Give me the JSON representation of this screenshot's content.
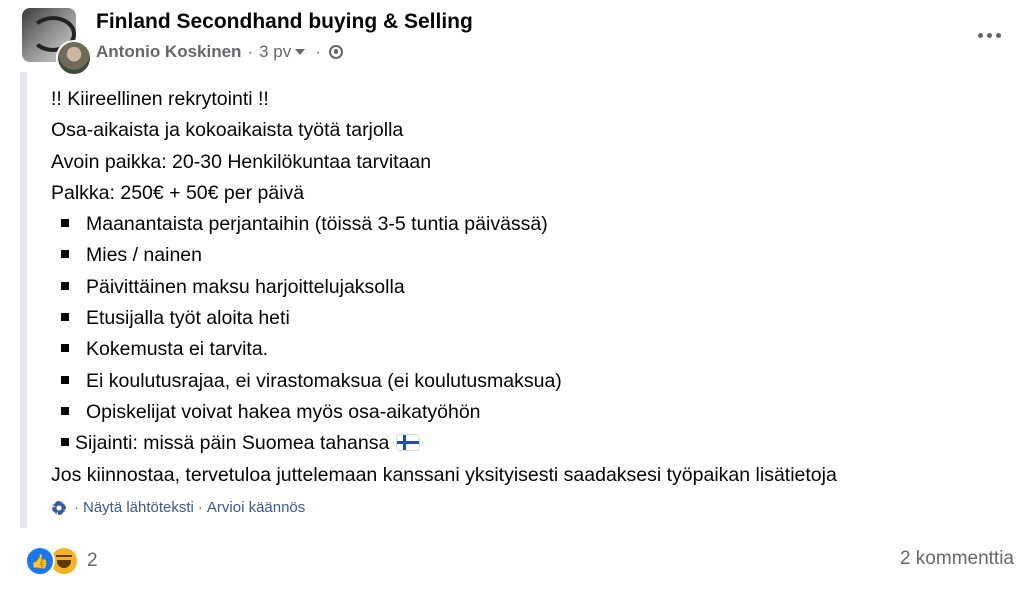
{
  "header": {
    "group_name": "Finland Secondhand buying & Selling",
    "author": "Antonio Koskinen",
    "separator": "·",
    "time": "3 pv",
    "privacy_icon": "globe-icon",
    "more_icon": "more-options-icon"
  },
  "post": {
    "lines": [
      "!!  Kiireellinen rekrytointi !!",
      "Osa-aikaista ja kokoaikaista työtä tarjolla",
      "Avoin paikka: 20-30 Henkilökuntaa tarvitaan",
      "Palkka: 250€ + 50€ per päivä"
    ],
    "bullets": [
      "Maanantaista perjantaihin (töissä 3-5 tuntia päivässä)",
      "Mies / nainen",
      "Päivittäinen maksu harjoittelujaksolla",
      "Etusijalla työt aloita heti",
      "Kokemusta ei tarvita.",
      "Ei koulutusrajaa, ei virastomaksua (ei koulutusmaksua)",
      "Opiskelijat voivat hakea myös osa-aikatyöhön",
      "Sijainti: missä päin Suomea tahansa"
    ],
    "location_flag": "finland-flag-icon",
    "closing": "Jos kiinnostaa, tervetuloa juttelemaan kanssani yksityisesti saadaksesi työpaikan lisätietoja"
  },
  "translation": {
    "icon": "gear-icon",
    "separator": "·",
    "show_original": "Näytä lähtöteksti",
    "rate": "Arvioi käännös"
  },
  "footer": {
    "reaction_icons": [
      "like-icon",
      "haha-icon"
    ],
    "reaction_count": "2",
    "comments": "2 kommenttia"
  },
  "colors": {
    "text": "#050505",
    "secondary": "#65676b",
    "link": "#385898",
    "like": "#1877f2",
    "haha": "#f7b125",
    "quote_bar": "#e4e6eb"
  }
}
